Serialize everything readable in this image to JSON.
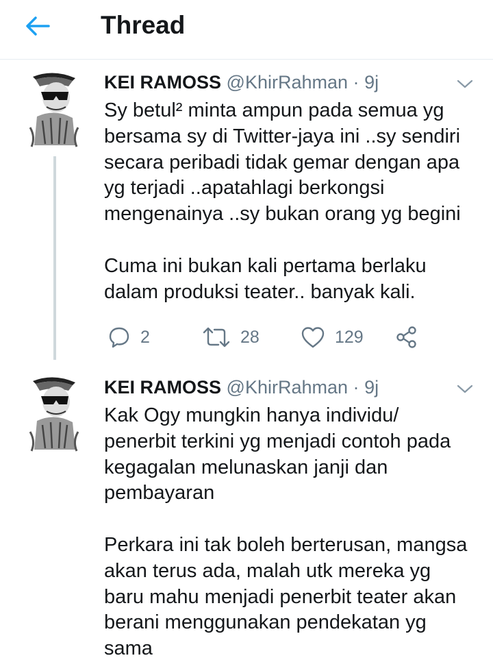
{
  "header": {
    "title": "Thread",
    "back_icon": "back-arrow-icon"
  },
  "accent_color": "#1da1f2",
  "tweets": [
    {
      "author_name": "KEI RAMOSS",
      "handle": "@KhirRahman",
      "separator": "·",
      "time": "9j",
      "paragraphs": [
        [
          "Sy betul² minta ampun pada semua yg",
          "bersama sy di Twitter-jaya ini ..sy sendiri",
          "secara peribadi tidak gemar dengan apa",
          "yg terjadi ..apatahlagi berkongsi",
          "mengenainya ..sy bukan orang yg begini"
        ],
        [
          "Cuma ini bukan kali pertama berlaku",
          "dalam produksi teater.. banyak kali."
        ]
      ],
      "replies": "2",
      "retweets": "28",
      "likes": "129"
    },
    {
      "author_name": "KEI RAMOSS",
      "handle": "@KhirRahman",
      "separator": "·",
      "time": "9j",
      "paragraphs": [
        [
          "Kak Ogy mungkin hanya individu/",
          "penerbit terkini yg menjadi contoh pada",
          "kegagalan melunaskan janji dan",
          "pembayaran"
        ],
        [
          "Perkara ini tak boleh berterusan, mangsa",
          "akan terus ada, malah utk mereka yg",
          "baru mahu menjadi penerbit teater akan",
          "berani menggunakan pendekatan yg",
          "sama"
        ]
      ]
    }
  ]
}
